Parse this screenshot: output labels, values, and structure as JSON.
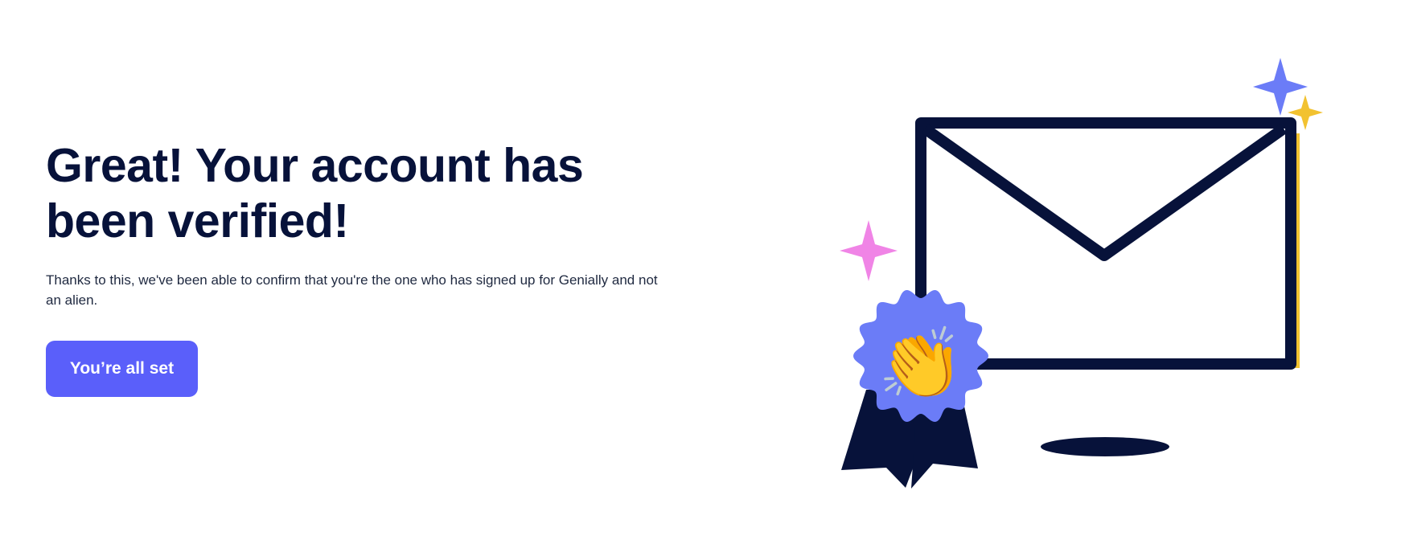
{
  "main": {
    "title": "Great! Your account has been verified!",
    "description": "Thanks to this, we've been able to confirm that you're the one who has signed up for Genially and not an alien.",
    "cta_label": "You’re all set"
  },
  "illustration": {
    "icons": [
      "envelope-icon",
      "award-ribbon-icon",
      "clapping-hands-icon",
      "sparkle-icon"
    ],
    "clap_glyph": "👏",
    "colors": {
      "navy": "#07123a",
      "yellow": "#f2c230",
      "blue": "#6b7cf7",
      "pink": "#f084e6",
      "button": "#5a5ffa"
    }
  }
}
